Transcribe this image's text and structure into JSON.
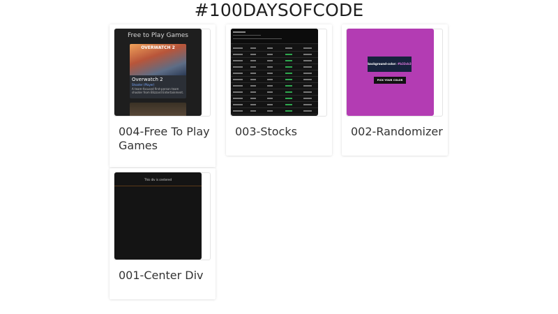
{
  "page": {
    "title": "#100DAYSOFCODE"
  },
  "projects": [
    {
      "title": "004-Free To Play Games",
      "thumb": {
        "heading": "Free to Play Games",
        "game_logo": "OVERWATCH 2",
        "game_name": "Overwatch 2",
        "game_genre": "Shooter (Player)",
        "game_desc": "A team-focused first-person team shooter from Blizzard Entertainment."
      }
    },
    {
      "title": "003-Stocks",
      "thumb": {}
    },
    {
      "title": "002-Randomizer",
      "thumb": {
        "label": "background-color:",
        "hex": "#b33cb3",
        "button": "PICK YOUR COLOR",
        "bg_color": "#b33cb3"
      }
    },
    {
      "title": "001-Center Div",
      "thumb": {
        "text": "This div is centered"
      }
    }
  ]
}
